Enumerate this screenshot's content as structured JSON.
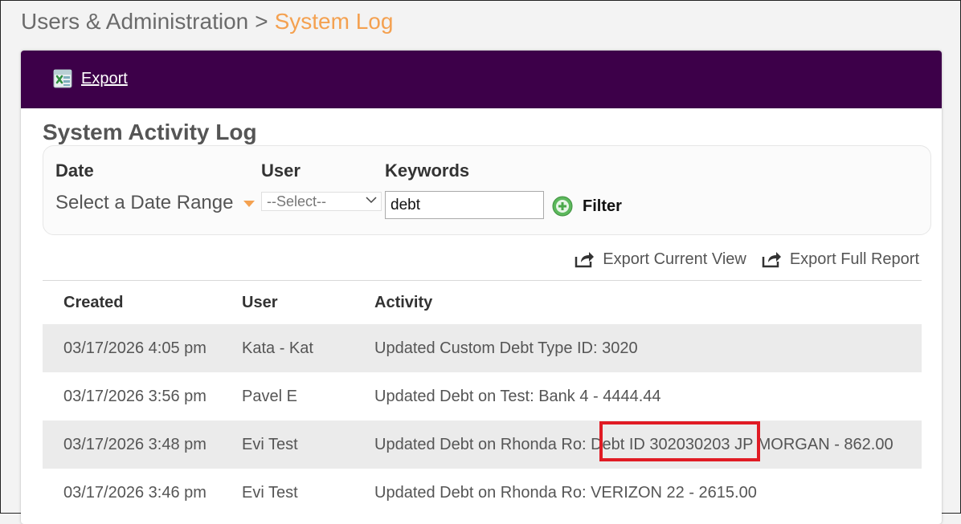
{
  "breadcrumb": {
    "parent": "Users & Administration",
    "separator": ">",
    "current": "System Log"
  },
  "header": {
    "export_label": "Export",
    "icon": "excel-icon"
  },
  "colors": {
    "header_bg": "#3d0049",
    "accent": "#f4a150",
    "highlight": "#e01b24"
  },
  "section_title": "System Activity Log",
  "filters": {
    "date_label": "Date",
    "date_value": "Select a Date Range",
    "user_label": "User",
    "user_value": "--Select--",
    "keywords_label": "Keywords",
    "keywords_value": "debt",
    "filter_button": "Filter"
  },
  "export_actions": {
    "current_view": "Export Current View",
    "full_report": "Export Full Report"
  },
  "table": {
    "columns": [
      "Created",
      "User",
      "Activity"
    ],
    "rows": [
      {
        "created": "03/17/2026 4:05 pm",
        "user": "Kata - Kat",
        "activity": "Updated Custom Debt Type ID: 3020"
      },
      {
        "created": "03/17/2026 3:56 pm",
        "user": "Pavel E",
        "activity": "Updated Debt on Test: Bank 4 - 4444.44"
      },
      {
        "created": "03/17/2026 3:48 pm",
        "user": "Evi Test",
        "activity": "Updated Debt on Rhonda Ro: Debt ID 302030203 JP MORGAN - 862.00"
      },
      {
        "created": "03/17/2026 3:46 pm",
        "user": "Evi Test",
        "activity": "Updated Debt on Rhonda Ro: VERIZON 22 - 2615.00"
      }
    ]
  }
}
